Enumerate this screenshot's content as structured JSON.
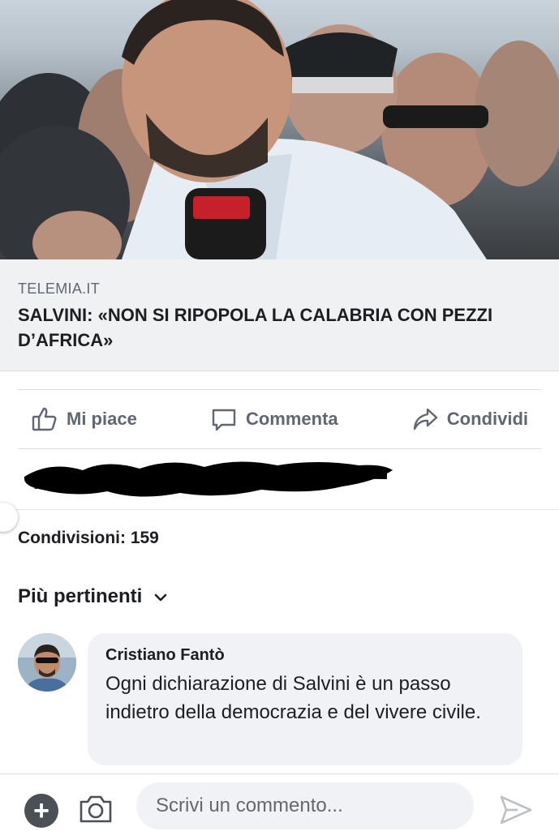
{
  "post": {
    "link_domain": "TELEMIA.IT",
    "link_title": "SALVINI: «NON SI RIPOPOLA LA CALABRIA CON PEZZI D’AFRICA»"
  },
  "actions": {
    "like_label": "Mi piace",
    "comment_label": "Commenta",
    "share_label": "Condividi"
  },
  "shares_text": "Condivisioni: 159",
  "sort": {
    "label": "Più pertinenti"
  },
  "comments": [
    {
      "author": "Cristiano Fantò",
      "text": "Ogni dichiarazione di Salvini è un passo indietro della democrazia e del vivere civile."
    }
  ],
  "composer": {
    "placeholder": "Scrivi un commento..."
  },
  "colors": {
    "link_meta_bg": "#f0f1f3",
    "action_gray": "#606770",
    "bubble_bg": "#f0f2f5"
  },
  "icons": [
    "like-icon",
    "comment-icon",
    "share-icon",
    "chevron-down-icon",
    "plus-icon",
    "camera-icon",
    "send-icon"
  ]
}
